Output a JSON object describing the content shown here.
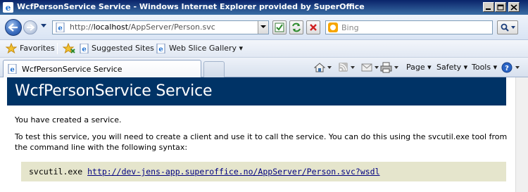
{
  "window": {
    "title": "WcfPersonService Service - Windows Internet Explorer provided by SuperOffice",
    "buttons": [
      "minimize",
      "maximize",
      "close"
    ]
  },
  "address_bar": {
    "url_prefix": "http://",
    "url_host": "localhost",
    "url_path": "/AppServer/Person.svc",
    "search_placeholder": "Bing"
  },
  "favorites_bar": {
    "favorites_label": "Favorites",
    "items": [
      {
        "label": "Suggested Sites ▾",
        "icon": "ie-page-icon"
      },
      {
        "label": "Web Slice Gallery ▾",
        "icon": "ie-page-icon"
      }
    ]
  },
  "tabs": [
    {
      "label": "WcfPersonService Service",
      "active": true
    }
  ],
  "command_bar": {
    "page_label": "Page ▾",
    "safety_label": "Safety ▾",
    "tools_label": "Tools ▾",
    "help_label": "?"
  },
  "page": {
    "heading": "WcfPersonService Service",
    "intro": "You have created a service.",
    "instructions": "To test this service, you will need to create a client and use it to call the service. You can do this using the svcutil.exe tool from the command line with the following syntax:",
    "command": "svcutil.exe",
    "wsdl_link": "http://dev-jens-app.superoffice.no/AppServer/Person.svc?wsdl"
  },
  "colors": {
    "heading_bg": "#003366",
    "code_bg": "#e5e5cc",
    "link": "#000080"
  }
}
